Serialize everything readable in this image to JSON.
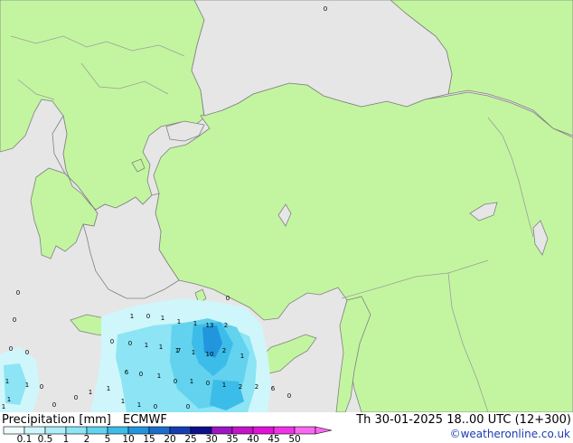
{
  "map": {
    "colors": {
      "sea": "#e6e6e6",
      "land": "#c3f5a0",
      "border": "#9aa09a",
      "coast": "#808080"
    },
    "precip_labels": [
      "0",
      "0",
      "0",
      "0",
      "0",
      "1",
      "0",
      "1",
      "1",
      "1",
      "0",
      "0",
      "1",
      "1",
      "1",
      "7",
      "1",
      "10",
      "2",
      "13",
      "2",
      "1",
      "6",
      "0",
      "1",
      "0",
      "1",
      "0",
      "1",
      "2",
      "2",
      "6",
      "1",
      "1",
      "1",
      "1",
      "1",
      "0",
      "0",
      "1",
      "0",
      "0",
      "0",
      "1",
      "1",
      "0",
      "0"
    ]
  },
  "footer": {
    "title": "Precipitation [mm]",
    "model": "ECMWF",
    "datetime": "Th 30-01-2025 18..00 UTC (12+300)",
    "credit": "©weatheronline.co.uk",
    "credit_color": "#1a3cb4"
  },
  "legend": {
    "ticks": [
      "0.1",
      "0.5",
      "1",
      "2",
      "5",
      "10",
      "15",
      "20",
      "25",
      "30",
      "35",
      "40",
      "45",
      "50"
    ],
    "colors": [
      "#eefcfe",
      "#cff6fb",
      "#aeeef8",
      "#8ce4f4",
      "#62d2ee",
      "#3cbce8",
      "#2296dc",
      "#1c6ccc",
      "#163cb4",
      "#0e0e8c",
      "#9c14c4",
      "#c414c8",
      "#e012d8",
      "#f032e8",
      "#f868f0"
    ]
  }
}
